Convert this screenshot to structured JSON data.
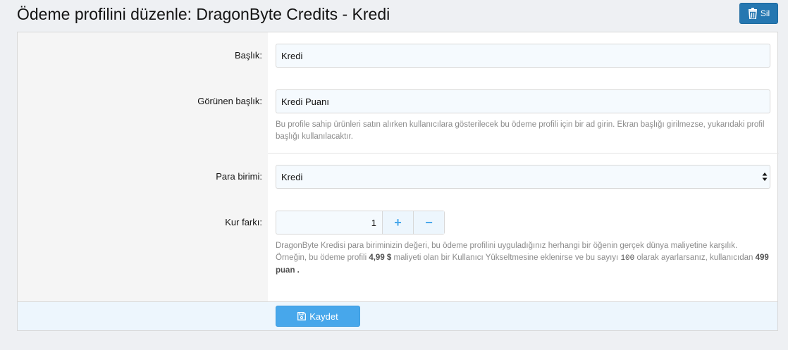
{
  "page": {
    "title": "Ödeme profilini düzenle: DragonByte Credits - Kredi"
  },
  "actions": {
    "delete_label": "Sil",
    "delete_icon": "trash-icon",
    "save_label": "Kaydet",
    "save_icon": "floppy-disk-icon"
  },
  "form": {
    "title_field": {
      "label": "Başlık:",
      "value": "Kredi"
    },
    "display_title_field": {
      "label": "Görünen başlık:",
      "value": "Kredi Puanı",
      "hint": "Bu profile sahip ürünleri satın alırken kullanıcılara gösterilecek bu ödeme profili için bir ad girin. Ekran başlığı girilmezse, yukarıdaki profil başlığı kullanılacaktır."
    },
    "currency_field": {
      "label": "Para birimi:",
      "selected": "Kredi"
    },
    "rate_field": {
      "label": "Kur farkı:",
      "value": "1",
      "increment": "+",
      "decrement": "−",
      "hint_line1": "DragonByte Kredisi para biriminizin değeri, bu ödeme profilini uyguladığınız herhangi bir öğenin gerçek dünya maliyetine karşılık.",
      "hint_line2_a": "Örneğin, bu ödeme profili ",
      "hint_line2_b": "4,99 $",
      "hint_line2_c": " maliyeti olan bir Kullanıcı Yükseltmesine eklenirse ve bu sayıyı ",
      "hint_line2_d": "100",
      "hint_line2_e": " olarak ayarlarsanız, kullanıcıdan ",
      "hint_line2_f": "499 puan .",
      "hint_line2_g": ""
    }
  },
  "colors": {
    "accent": "#47a7eb",
    "delete_button": "#2577b1",
    "input_bg": "#f5fafe"
  }
}
